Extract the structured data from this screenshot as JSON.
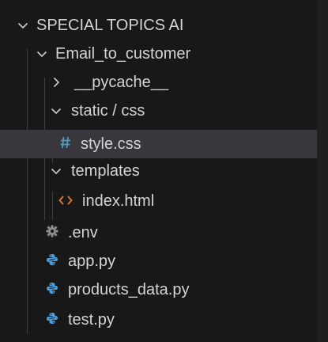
{
  "explorer": {
    "root_folder": "SPECIAL TOPICS AI",
    "items": [
      {
        "label": "Email_to_customer",
        "kind": "folder",
        "expanded": true
      },
      {
        "label": "__pycache__",
        "kind": "folder",
        "expanded": false
      },
      {
        "label": "static / css",
        "kind": "folder",
        "expanded": true
      },
      {
        "label": "style.css",
        "kind": "file",
        "icon": "css-hash-icon",
        "selected": true
      },
      {
        "label": "templates",
        "kind": "folder",
        "expanded": true
      },
      {
        "label": "index.html",
        "kind": "file",
        "icon": "html-tag-icon"
      },
      {
        "label": ".env",
        "kind": "file",
        "icon": "gear-icon"
      },
      {
        "label": "app.py",
        "kind": "file",
        "icon": "python-icon"
      },
      {
        "label": "products_data.py",
        "kind": "file",
        "icon": "python-icon"
      },
      {
        "label": "test.py",
        "kind": "file",
        "icon": "python-icon"
      }
    ]
  },
  "colors": {
    "background": "#181818",
    "selected_row": "#37373d",
    "text": "#d4d4d4",
    "css_icon": "#519aba",
    "html_icon": "#e37933",
    "python_icon": "#4c9bd6",
    "gear_icon": "#8c8c8c"
  }
}
